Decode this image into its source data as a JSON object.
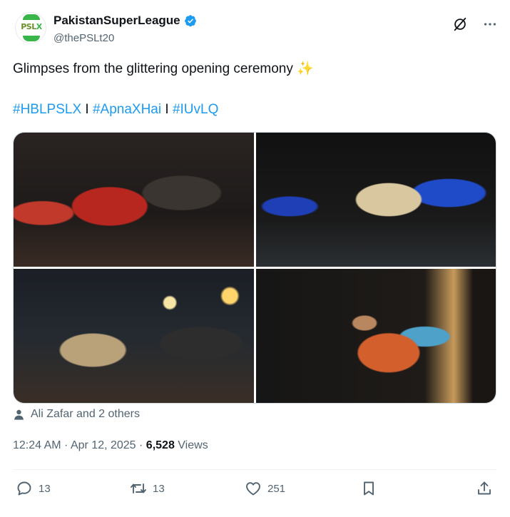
{
  "author": {
    "display_name": "PakistanSuperLeague",
    "handle": "@thePSLt20",
    "verified": true,
    "avatar_logo_text": "PSL X"
  },
  "tweet": {
    "text": "Glimpses from the glittering opening ceremony",
    "emoji": "✨",
    "hashtags": [
      "#HBLPSLX",
      "#ApnaXHai",
      "#IUvLQ"
    ],
    "separator": " I "
  },
  "media": {
    "count": 4,
    "images": [
      {
        "name": "photo-performers-red-outfit"
      },
      {
        "name": "photo-singer-on-stage"
      },
      {
        "name": "photo-rappers-on-stage"
      },
      {
        "name": "photo-singer-colorful-jacket"
      }
    ]
  },
  "tagged": {
    "text": "Ali Zafar and 2 others"
  },
  "meta": {
    "time": "12:24 AM",
    "dot": " · ",
    "date": "Apr 12, 2025",
    "views_count": "6,528",
    "views_label": "Views"
  },
  "actions": {
    "replies": "13",
    "reposts": "13",
    "likes": "251"
  },
  "colors": {
    "link": "#1d9bf0",
    "text": "#0f1419",
    "secondary": "#536471",
    "verified": "#1d9bf0"
  },
  "icons": [
    "grok-icon",
    "more-icon",
    "verified-badge-icon",
    "person-icon",
    "reply-icon",
    "retweet-icon",
    "like-icon",
    "bookmark-icon",
    "share-icon"
  ]
}
